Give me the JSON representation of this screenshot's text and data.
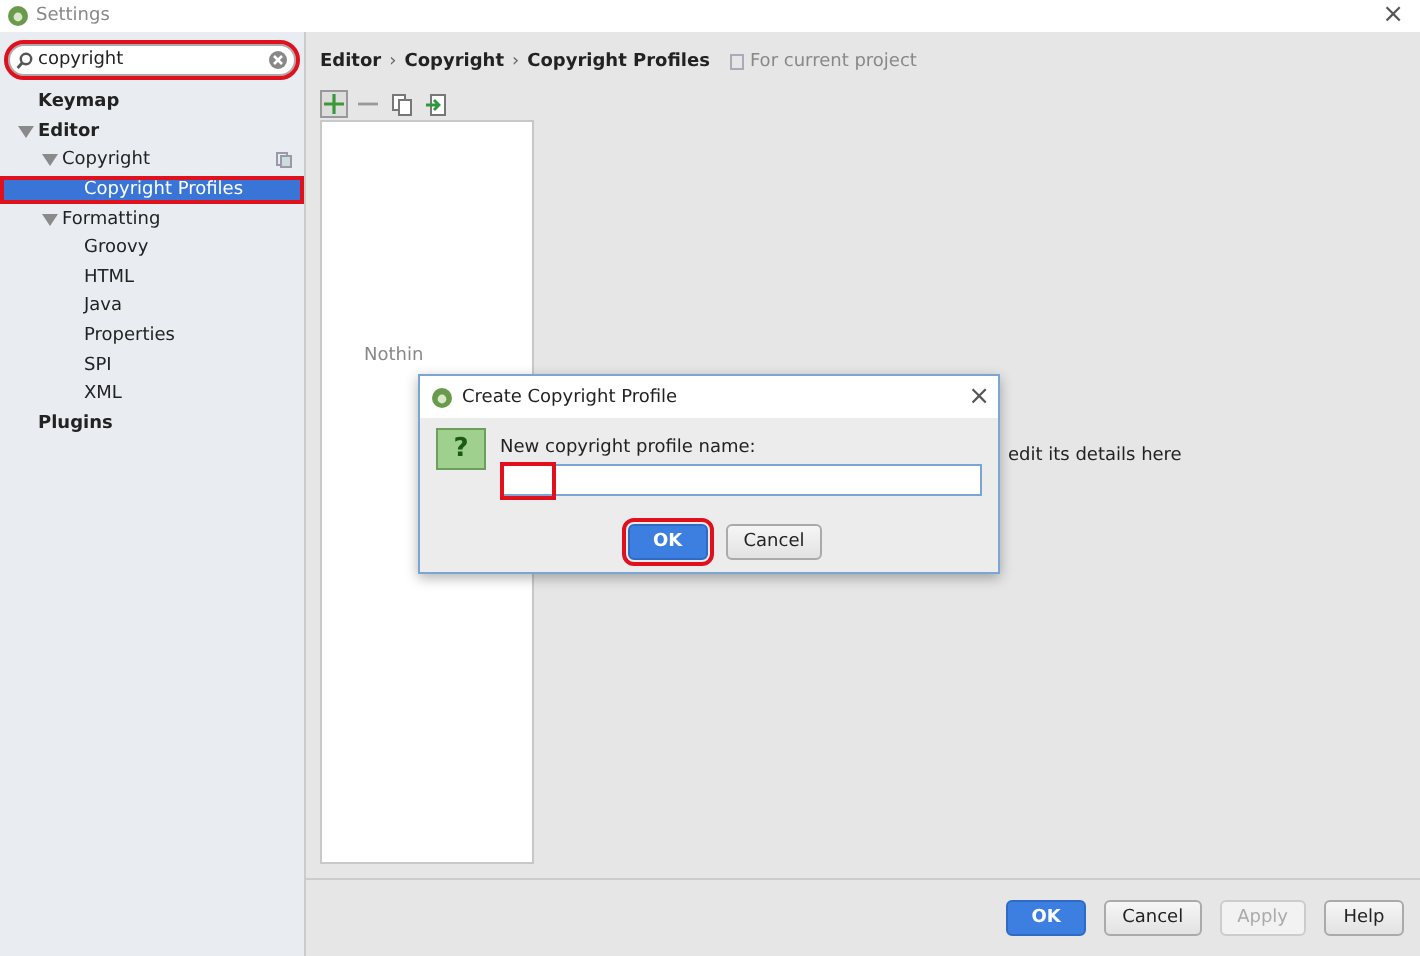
{
  "window": {
    "title": "Settings",
    "close": "×"
  },
  "search": {
    "value": "copyright",
    "highlighted": true
  },
  "tree": [
    {
      "label": "Keymap",
      "bold": true,
      "selected": false
    },
    {
      "label": "Editor",
      "bold": true,
      "expanded": true,
      "selected": false,
      "children": [
        {
          "label": "Copyright",
          "expanded": true,
          "selected": false,
          "project_icon": true,
          "children": [
            {
              "label": "Copyright Profiles",
              "selected": true,
              "highlighted": true
            }
          ]
        },
        {
          "label": "Formatting",
          "expanded": true,
          "selected": false,
          "children": [
            {
              "label": "Groovy",
              "selected": false
            },
            {
              "label": "HTML",
              "selected": false
            },
            {
              "label": "Java",
              "selected": false
            },
            {
              "label": "Properties",
              "selected": false
            },
            {
              "label": "SPI",
              "selected": false
            },
            {
              "label": "XML",
              "selected": false
            }
          ]
        }
      ]
    },
    {
      "label": "Plugins",
      "bold": true,
      "selected": false
    }
  ],
  "breadcrumb": [
    "Editor",
    "Copyright",
    "Copyright Profiles"
  ],
  "breadcrumb_separator": "›",
  "scope": "For current project",
  "list_empty_text": "Nothin",
  "hint_text": "edit its details here",
  "dialog": {
    "title": "Create Copyright Profile",
    "close": "×",
    "icon": "?",
    "label": "New copyright profile name:",
    "input": {
      "highlighted": true
    },
    "buttons": [
      {
        "label": "OK",
        "default": true,
        "highlighted": true
      },
      {
        "label": "Cancel",
        "default": false,
        "highlighted": false
      }
    ]
  },
  "buttons": [
    {
      "label": "OK",
      "default": true,
      "disabled": false
    },
    {
      "label": "Cancel",
      "default": false,
      "disabled": false
    },
    {
      "label": "Apply",
      "default": false,
      "disabled": true
    },
    {
      "label": "Help",
      "default": false,
      "disabled": false
    }
  ]
}
